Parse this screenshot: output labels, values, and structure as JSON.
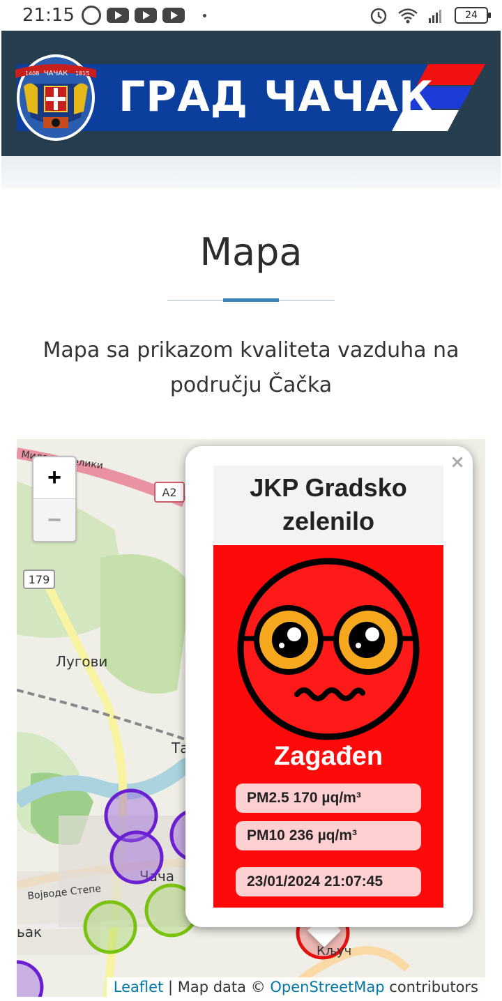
{
  "status_bar": {
    "time": "21:15",
    "battery": "24"
  },
  "header": {
    "title": "ГРАД ЧАЧАК",
    "crest_year_left": "1408",
    "crest_year_right": "1815",
    "crest_text": "ЧАЧАК"
  },
  "page": {
    "title": "Mapa",
    "subtitle": "Mapa sa prikazom kvaliteta vazduha na području Čačka"
  },
  "map": {
    "zoom_in": "+",
    "zoom_out": "−",
    "labels": {
      "road_top": "Милошa Велики",
      "a2": "A2",
      "r179": "179",
      "lugovi": "Лугови",
      "vojvode": "Војводе Степе",
      "cacak": "Чача",
      "ljak": "ьак",
      "t": "Та",
      "kljuc": "Кључ"
    },
    "attribution": {
      "leaflet": "Leaflet",
      "sep": " | Map data © ",
      "osm": "OpenStreetMap",
      "contrib": " contributors"
    },
    "marker_colors": {
      "purple": "#6a1fd1",
      "green": "#79c20f",
      "red": "#e51010"
    }
  },
  "popup": {
    "close": "×",
    "station": "JKP Gradsko zelenilo",
    "status": "Zagađen",
    "pm25": "PM2.5 170 µq/m³",
    "pm10": "PM10 236 µq/m³",
    "timestamp": "23/01/2024 21:07:45",
    "color": "#ff0a0a"
  }
}
